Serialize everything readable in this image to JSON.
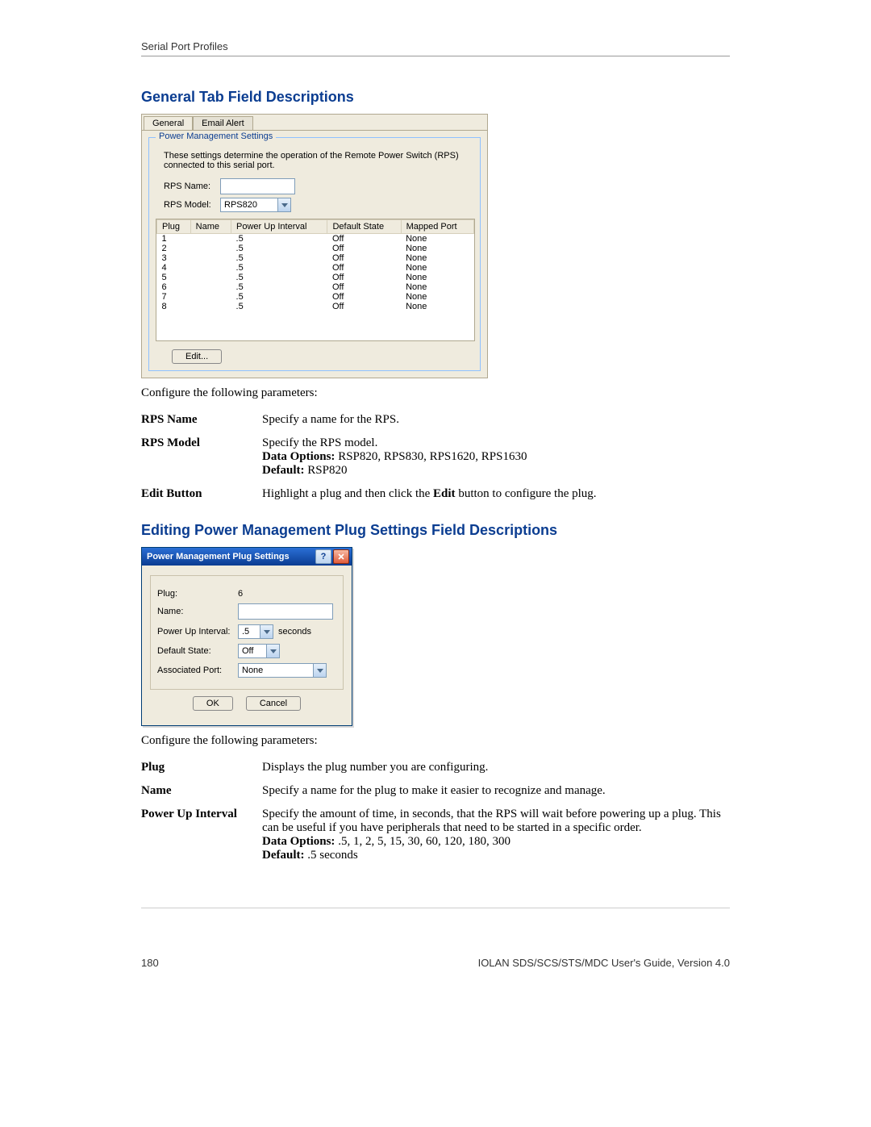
{
  "header": {
    "section": "Serial Port Profiles"
  },
  "section1": {
    "title": "General Tab Field Descriptions",
    "intro": "Configure the following parameters:",
    "params": [
      {
        "key": "RPS Name",
        "desc": "Specify a name for the RPS."
      },
      {
        "key": "RPS Model",
        "desc": "Specify the RPS model.",
        "data_options_label": "Data Options:",
        "data_options": " RSP820, RPS830, RPS1620, RPS1630",
        "default_label": "Default:",
        "default": " RSP820"
      },
      {
        "key": "Edit Button",
        "desc_pre": "Highlight a plug and then click the ",
        "desc_bold": "Edit",
        "desc_post": " button to configure the plug."
      }
    ]
  },
  "ui_main": {
    "tabs": [
      {
        "label": "General",
        "active": true
      },
      {
        "label": "Email Alert",
        "active": false
      }
    ],
    "fieldset_title": "Power Management Settings",
    "intro": "These settings determine the operation of the Remote Power Switch (RPS) connected to this serial port.",
    "rps_name_label": "RPS Name:",
    "rps_name_value": "",
    "rps_model_label": "RPS Model:",
    "rps_model_value": "RPS820",
    "columns": [
      "Plug",
      "Name",
      "Power Up Interval",
      "Default State",
      "Mapped Port"
    ],
    "rows": [
      {
        "plug": "1",
        "name": "",
        "interval": ".5",
        "state": "Off",
        "port": "None"
      },
      {
        "plug": "2",
        "name": "",
        "interval": ".5",
        "state": "Off",
        "port": "None"
      },
      {
        "plug": "3",
        "name": "",
        "interval": ".5",
        "state": "Off",
        "port": "None"
      },
      {
        "plug": "4",
        "name": "",
        "interval": ".5",
        "state": "Off",
        "port": "None"
      },
      {
        "plug": "5",
        "name": "",
        "interval": ".5",
        "state": "Off",
        "port": "None"
      },
      {
        "plug": "6",
        "name": "",
        "interval": ".5",
        "state": "Off",
        "port": "None"
      },
      {
        "plug": "7",
        "name": "",
        "interval": ".5",
        "state": "Off",
        "port": "None"
      },
      {
        "plug": "8",
        "name": "",
        "interval": ".5",
        "state": "Off",
        "port": "None"
      }
    ],
    "edit_button": "Edit..."
  },
  "section2": {
    "title": "Editing Power Management Plug Settings Field Descriptions",
    "intro": "Configure the following parameters:",
    "params": [
      {
        "key": "Plug",
        "desc": "Displays the plug number you are configuring."
      },
      {
        "key": "Name",
        "desc": "Specify a name for the plug to make it easier to recognize and manage."
      },
      {
        "key": "Power Up Interval",
        "desc": "Specify the amount of time, in seconds, that the RPS will wait before powering up a plug. This can be useful if you have peripherals that need to be started in a specific order.",
        "data_options_label": "Data Options:",
        "data_options": " .5, 1, 2, 5, 15, 30, 60, 120, 180, 300",
        "default_label": "Default:",
        "default": " .5 seconds"
      }
    ]
  },
  "dialog": {
    "title": "Power Management Plug Settings",
    "plug_label": "Plug:",
    "plug_value": "6",
    "name_label": "Name:",
    "name_value": "",
    "interval_label": "Power Up Interval:",
    "interval_value": ".5",
    "interval_unit": "seconds",
    "state_label": "Default State:",
    "state_value": "Off",
    "port_label": "Associated Port:",
    "port_value": "None",
    "ok": "OK",
    "cancel": "Cancel"
  },
  "footer": {
    "page": "180",
    "doc": "IOLAN SDS/SCS/STS/MDC User's Guide, Version 4.0"
  }
}
